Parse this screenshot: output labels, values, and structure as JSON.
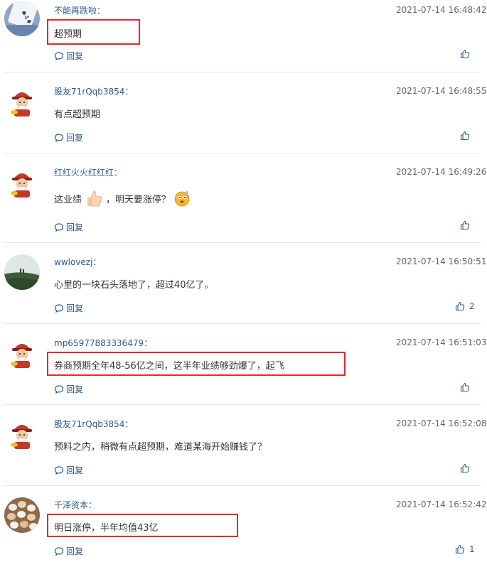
{
  "comments": [
    {
      "author": "不能再跌啦：",
      "time": "2021-07-14 16:48:42",
      "text": "超预期",
      "reply": "回复",
      "likes": ""
    },
    {
      "author": "股友71rQqb3854：",
      "time": "2021-07-14 16:48:55",
      "text": "有点超预期",
      "reply": "回复",
      "likes": ""
    },
    {
      "author": "红红火火红红红：",
      "time": "2021-07-14 16:49:26",
      "text_a": "这业绩",
      "text_b": "，明天要涨停？",
      "reply": "回复",
      "likes": ""
    },
    {
      "author": "wwlovezj：",
      "time": "2021-07-14 16:50:51",
      "text": "心里的一块石头落地了，超过40亿了。",
      "reply": "回复",
      "likes": "2"
    },
    {
      "author": "mp65977883336479：",
      "time": "2021-07-14 16:51:03",
      "text": "券商预期全年48-56亿之间，这半年业绩够劲爆了，起飞",
      "reply": "回复",
      "likes": ""
    },
    {
      "author": "股友71rQqb3854：",
      "time": "2021-07-14 16:52:08",
      "text": "预料之内，稍微有点超预期，难道某海开始赚钱了？",
      "reply": "回复",
      "likes": ""
    },
    {
      "author": "千泽资本：",
      "time": "2021-07-14 16:52:42",
      "text": "明日涨停，半年均值43亿",
      "reply": "回复",
      "likes": "1"
    }
  ],
  "colors": {
    "link": "#2b5a92",
    "highlight": "#e2292e"
  },
  "icons": {
    "reply": "comment-bubble-icon",
    "like": "thumbs-up-icon"
  }
}
